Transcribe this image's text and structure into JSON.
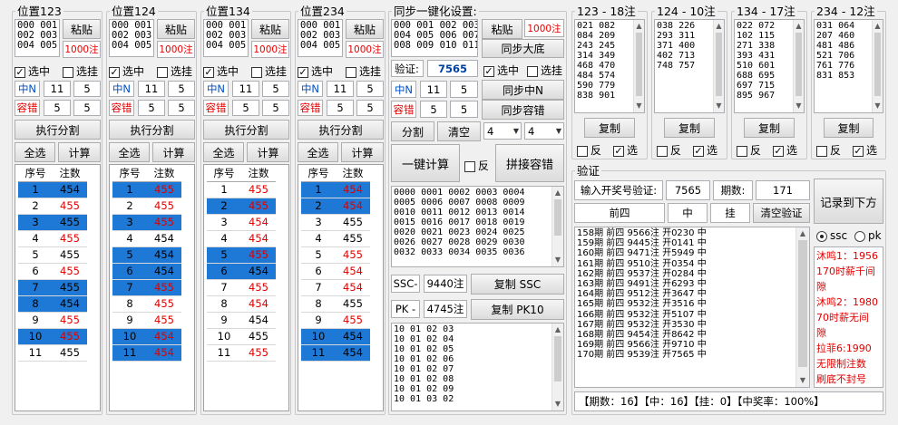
{
  "groups": [
    {
      "title": "位置123",
      "nums": "000 001\n002 003\n004 005",
      "paste": "粘贴",
      "count": "1000注",
      "select_mid": "选中",
      "select_hang": "选挂",
      "n_label": "中N",
      "n1": "11",
      "n2": "5",
      "r_label": "容错",
      "r1": "5",
      "r2": "5",
      "exec": "执行分割",
      "select_all": "全选",
      "calc": "计算",
      "h_idx": "序号",
      "h_count": "注数",
      "rows": [
        [
          "1",
          "454"
        ],
        [
          "2",
          "455"
        ],
        [
          "3",
          "455"
        ],
        [
          "4",
          "455"
        ],
        [
          "5",
          "455"
        ],
        [
          "6",
          "455"
        ],
        [
          "7",
          "455"
        ],
        [
          "8",
          "454"
        ],
        [
          "9",
          "455"
        ],
        [
          "10",
          "455"
        ],
        [
          "11",
          "455"
        ]
      ]
    },
    {
      "title": "位置124",
      "nums": "000 001\n002 003\n004 005",
      "paste": "粘贴",
      "count": "1000注",
      "select_mid": "选中",
      "select_hang": "选挂",
      "n_label": "中N",
      "n1": "11",
      "n2": "5",
      "r_label": "容错",
      "r1": "5",
      "r2": "5",
      "exec": "执行分割",
      "select_all": "全选",
      "calc": "计算",
      "h_idx": "序号",
      "h_count": "注数",
      "rows": [
        [
          "1",
          "455"
        ],
        [
          "2",
          "455"
        ],
        [
          "3",
          "455"
        ],
        [
          "4",
          "454"
        ],
        [
          "5",
          "454"
        ],
        [
          "6",
          "454"
        ],
        [
          "7",
          "455"
        ],
        [
          "8",
          "455"
        ],
        [
          "9",
          "455"
        ],
        [
          "10",
          "454"
        ],
        [
          "11",
          "454"
        ]
      ]
    },
    {
      "title": "位置134",
      "nums": "000 001\n002 003\n004 005",
      "paste": "粘贴",
      "count": "1000注",
      "select_mid": "选中",
      "select_hang": "选挂",
      "n_label": "中N",
      "n1": "11",
      "n2": "5",
      "r_label": "容错",
      "r1": "5",
      "r2": "5",
      "exec": "执行分割",
      "select_all": "全选",
      "calc": "计算",
      "h_idx": "序号",
      "h_count": "注数",
      "rows": [
        [
          "1",
          "455"
        ],
        [
          "2",
          "455"
        ],
        [
          "3",
          "454"
        ],
        [
          "4",
          "454"
        ],
        [
          "5",
          "455"
        ],
        [
          "6",
          "454"
        ],
        [
          "7",
          "455"
        ],
        [
          "8",
          "454"
        ],
        [
          "9",
          "454"
        ],
        [
          "10",
          "455"
        ],
        [
          "11",
          "455"
        ]
      ]
    },
    {
      "title": "位置234",
      "nums": "000 001\n002 003\n004 005",
      "paste": "粘贴",
      "count": "1000注",
      "select_mid": "选中",
      "select_hang": "选挂",
      "n_label": "中N",
      "n1": "11",
      "n2": "5",
      "r_label": "容错",
      "r1": "5",
      "r2": "5",
      "exec": "执行分割",
      "select_all": "全选",
      "calc": "计算",
      "h_idx": "序号",
      "h_count": "注数",
      "rows": [
        [
          "1",
          "454"
        ],
        [
          "2",
          "454"
        ],
        [
          "3",
          "455"
        ],
        [
          "4",
          "455"
        ],
        [
          "5",
          "455"
        ],
        [
          "6",
          "454"
        ],
        [
          "7",
          "454"
        ],
        [
          "8",
          "455"
        ],
        [
          "9",
          "455"
        ],
        [
          "10",
          "454"
        ],
        [
          "11",
          "454"
        ]
      ]
    }
  ],
  "row_styles": [
    {
      "sel": [
        true,
        false,
        true,
        false,
        false,
        false,
        true,
        true,
        false,
        true,
        false
      ],
      "red": [
        false,
        true,
        false,
        true,
        false,
        true,
        false,
        false,
        true,
        true,
        false
      ]
    },
    {
      "sel": [
        true,
        false,
        true,
        false,
        true,
        true,
        true,
        false,
        false,
        true,
        true
      ],
      "red": [
        true,
        true,
        true,
        false,
        false,
        false,
        true,
        true,
        true,
        true,
        true
      ]
    },
    {
      "sel": [
        false,
        true,
        false,
        false,
        true,
        true,
        false,
        false,
        false,
        false,
        false
      ],
      "red": [
        true,
        true,
        true,
        true,
        true,
        false,
        true,
        true,
        false,
        false,
        true
      ]
    },
    {
      "sel": [
        true,
        true,
        false,
        false,
        false,
        false,
        false,
        false,
        false,
        true,
        true
      ],
      "red": [
        true,
        true,
        false,
        false,
        true,
        true,
        true,
        false,
        true,
        false,
        false
      ]
    }
  ],
  "sync": {
    "title": "同步一键化设置:",
    "nums": "000 001 002 003\n004 005 006 007\n008 009 010 011",
    "paste": "粘贴",
    "count": "1000注",
    "sync_big": "同步大底",
    "verify_label": "验证:",
    "verify_value": "7565",
    "select_mid": "选中",
    "select_hang": "选挂",
    "n_label": "中N",
    "n1": "11",
    "n2": "5",
    "sync_n": "同步中N",
    "r_label": "容错",
    "r1": "5",
    "r2": "5",
    "sync_r": "同步容错",
    "split": "分割",
    "clear": "清空",
    "dd1": "4",
    "dd2": "4",
    "one_key": "一键计算",
    "reverse": "反",
    "merge": "拼接容错",
    "list": "0000 0001 0002 0003 0004\n0005 0006 0007 0008 0009\n0010 0011 0012 0013 0014\n0015 0016 0017 0018 0019\n0020 0021 0023 0024 0025\n0026 0027 0028 0029 0030\n0032 0033 0034 0035 0036",
    "ssc_label": "SSC-",
    "ssc_count": "9440注",
    "copy_ssc": "复制 SSC",
    "pk_label": "PK -",
    "pk_count": "4745注",
    "copy_pk": "复制 PK10",
    "pk_list": "10 01 02 03\n10 01 02 04\n10 01 02 05\n10 01 02 06\n10 01 02 07\n10 01 02 08\n10 01 02 09\n10 01 03 02"
  },
  "results": [
    {
      "title": "123 - 18注",
      "list": "021 082\n084 209\n243 245\n314 349\n468 470\n484 574\n590 779\n838 901",
      "copy": "复制",
      "reverse": "反",
      "select": "选"
    },
    {
      "title": "124 - 10注",
      "list": "038 226\n293 311\n371 400\n402 713\n748 757",
      "copy": "复制",
      "reverse": "反",
      "select": "选"
    },
    {
      "title": "134 - 17注",
      "list": "022 072\n102 115\n271 338\n393 431\n510 601\n688 695\n697 715\n895 967",
      "copy": "复制",
      "reverse": "反",
      "select": "选"
    },
    {
      "title": "234 - 12注",
      "list": "031 064\n207 460\n481 486\n521 706\n761 776\n831 853",
      "copy": "复制",
      "reverse": "反",
      "select": "选"
    }
  ],
  "verify": {
    "title": "验证",
    "input_label": "输入开奖号验证:",
    "input_value": "7565",
    "period_label": "期数:",
    "period_value": "171",
    "record": "记录到下方",
    "col1": "前四",
    "col2": "中",
    "col3": "挂",
    "clear": "清空验证",
    "log": "158期 前四 9566注 开0230 中\n159期 前四 9445注 开0141 中\n160期 前四 9471注 开5949 中\n161期 前四 9510注 开0354 中\n162期 前四 9537注 开0284 中\n163期 前四 9491注 开6293 中\n164期 前四 9512注 开3647 中\n165期 前四 9532注 开3516 中\n166期 前四 9532注 开5107 中\n167期 前四 9532注 开3530 中\n168期 前四 9454注 开8642 中\n169期 前四 9566注 开9710 中\n170期 前四 9539注 开7565 中",
    "radio_ssc": "ssc",
    "radio_pk": "pk",
    "notes": "沐鸣1：1956\n170时薪千间\n隙\n沐鸣2：1980\n70时薪无间\n隙\n拉菲6:1990\n无限制注数\n刷底不封号",
    "status": "【期数：16】【中：16】【挂：0】【中奖率：100%】"
  }
}
